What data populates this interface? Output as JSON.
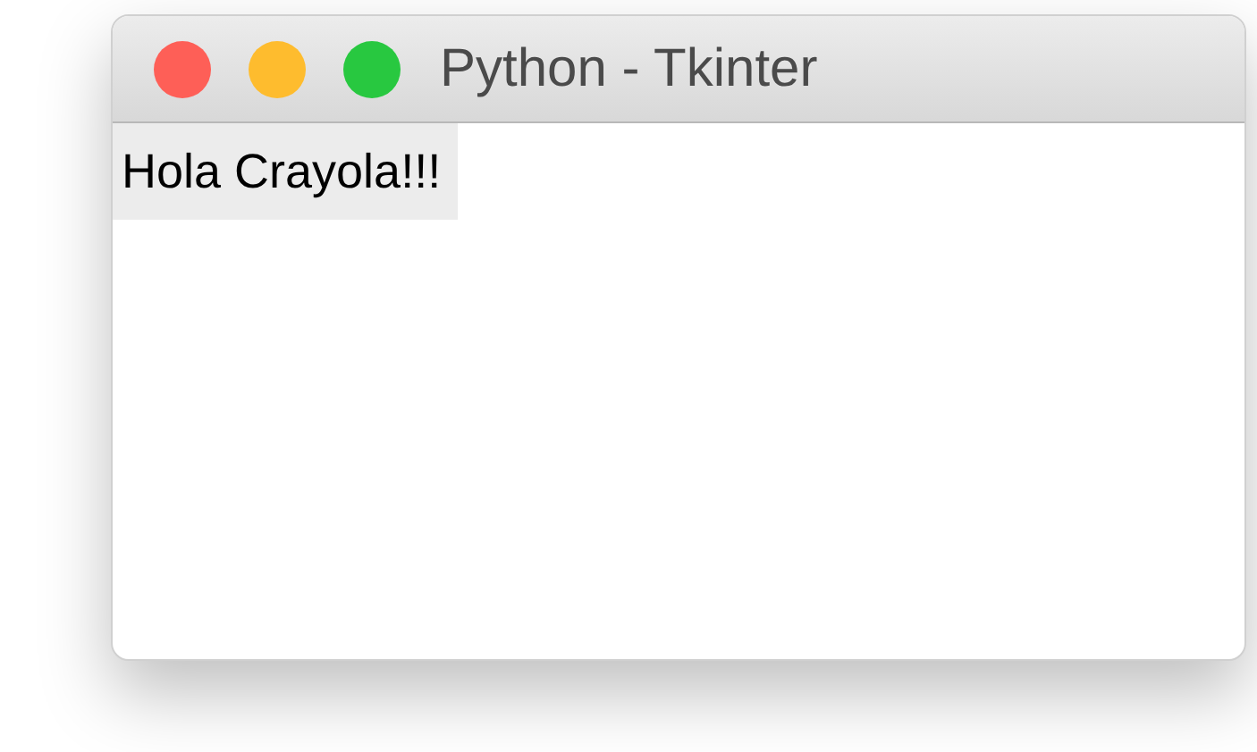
{
  "window": {
    "title": "Python - Tkinter",
    "controls": [
      {
        "color": "#fe5f57"
      },
      {
        "color": "#febc2e"
      },
      {
        "color": "#28c840"
      }
    ]
  },
  "label": {
    "text": "Hola Crayola!!!"
  }
}
